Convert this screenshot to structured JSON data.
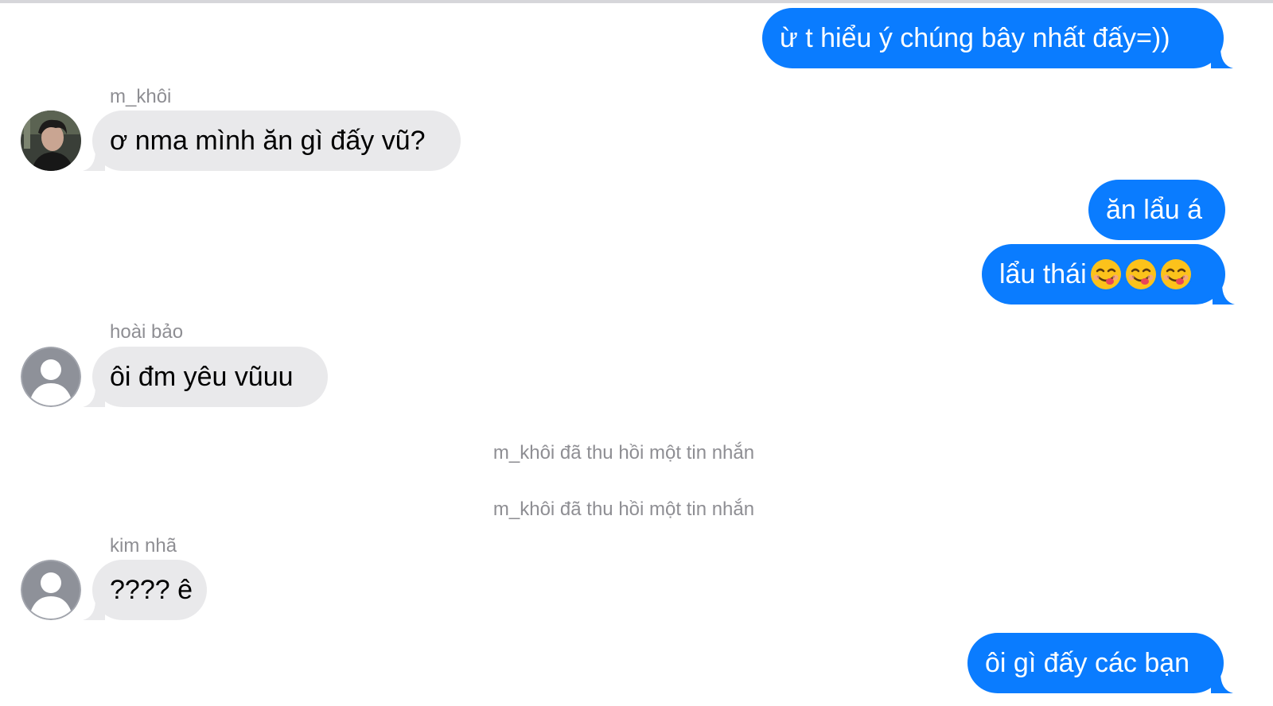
{
  "conversation": {
    "messages": [
      {
        "type": "outgoing",
        "text": "ừ t hiểu ý chúng bây nhất đấy=))"
      },
      {
        "type": "incoming",
        "sender": "m_khôi",
        "text": "ơ nma mình ăn gì đấy vũ?",
        "avatar": "photo"
      },
      {
        "type": "outgoing",
        "text": "ăn lẩu á"
      },
      {
        "type": "outgoing",
        "text": "lẩu thái",
        "emoji": [
          "yum-face-icon",
          "yum-face-icon",
          "yum-face-icon"
        ]
      },
      {
        "type": "incoming",
        "sender": "hoài bảo",
        "text": "ôi đm yêu vũuu",
        "avatar": "default"
      },
      {
        "type": "system",
        "text": "m_khôi đã thu hồi một tin nhắn"
      },
      {
        "type": "system",
        "text": "m_khôi đã thu hồi một tin nhắn"
      },
      {
        "type": "incoming",
        "sender": "kim nhã",
        "text": "???? ê",
        "avatar": "default"
      },
      {
        "type": "outgoing",
        "text": "ôi gì đấy các bạn"
      }
    ]
  },
  "colors": {
    "outgoing_bubble": "#0a7cff",
    "incoming_bubble": "#e9e9eb",
    "meta_text": "#8e8e93"
  }
}
